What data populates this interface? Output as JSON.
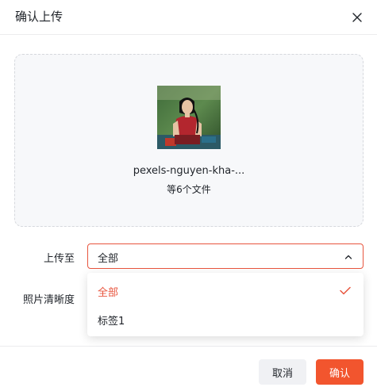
{
  "dialog": {
    "title": "确认上传",
    "close_icon": "close-icon"
  },
  "upload": {
    "file_name": "pexels-nguyen-kha-...",
    "file_count": "等6个文件"
  },
  "form": {
    "upload_to_label": "上传至",
    "quality_label": "照片清晰度",
    "selected_value": "全部",
    "options": [
      {
        "label": "全部",
        "selected": true
      },
      {
        "label": "标签1",
        "selected": false
      }
    ]
  },
  "footer": {
    "cancel_label": "取消",
    "confirm_label": "确认"
  },
  "colors": {
    "accent": "#f2552e",
    "selected_text": "#e8553e"
  }
}
